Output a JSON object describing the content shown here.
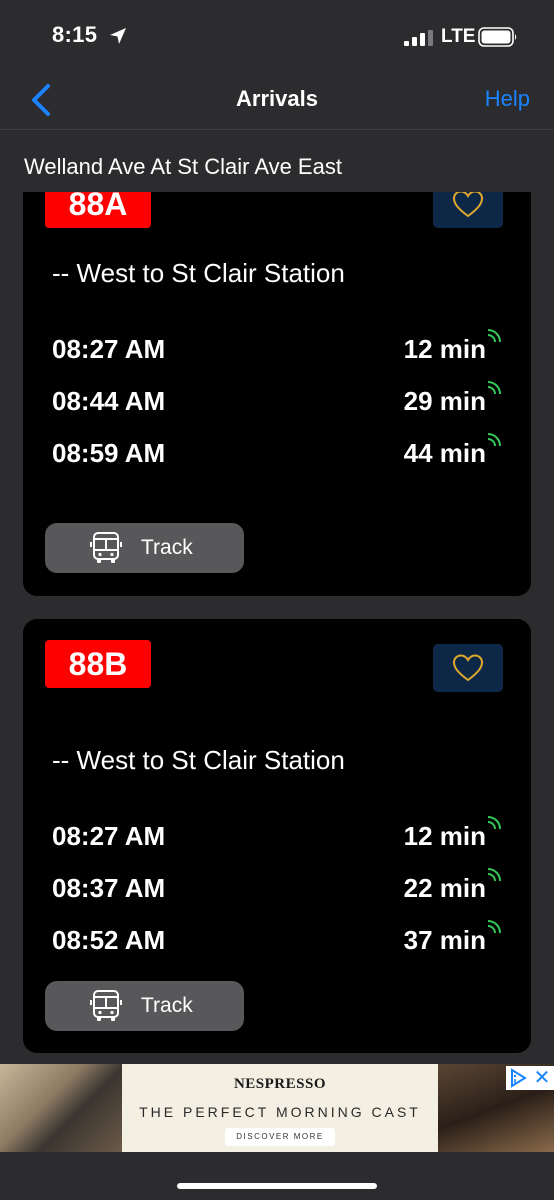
{
  "status_bar": {
    "time": "8:15",
    "network": "LTE"
  },
  "nav": {
    "title": "Arrivals",
    "help_label": "Help"
  },
  "stop": {
    "name": "Welland Ave At St Clair Ave East"
  },
  "cards": [
    {
      "route": "88A",
      "direction": "-- West to St Clair Station",
      "arrivals": [
        {
          "time": "08:27 AM",
          "eta": "12 min"
        },
        {
          "time": "08:44 AM",
          "eta": "29 min"
        },
        {
          "time": "08:59 AM",
          "eta": "44 min"
        }
      ],
      "track_label": "Track"
    },
    {
      "route": "88B",
      "direction": "-- West to St Clair Station",
      "arrivals": [
        {
          "time": "08:27 AM",
          "eta": "12 min"
        },
        {
          "time": "08:37 AM",
          "eta": "22 min"
        },
        {
          "time": "08:52 AM",
          "eta": "37 min"
        }
      ],
      "track_label": "Track"
    }
  ],
  "ad": {
    "brand": "NESPRESSO",
    "tagline": "THE PERFECT MORNING CAST",
    "cta": "DISCOVER MORE",
    "close": "✕"
  },
  "colors": {
    "accent": "#1a84ff",
    "route_badge": "#ff0000",
    "realtime": "#34c759",
    "favorite_heart": "#e0a82e"
  },
  "icons": [
    "location-arrow-icon",
    "signal-icon",
    "battery-icon",
    "chevron-left-icon",
    "heart-icon",
    "realtime-signal-icon",
    "bus-icon",
    "ad-choices-icon",
    "close-icon"
  ]
}
